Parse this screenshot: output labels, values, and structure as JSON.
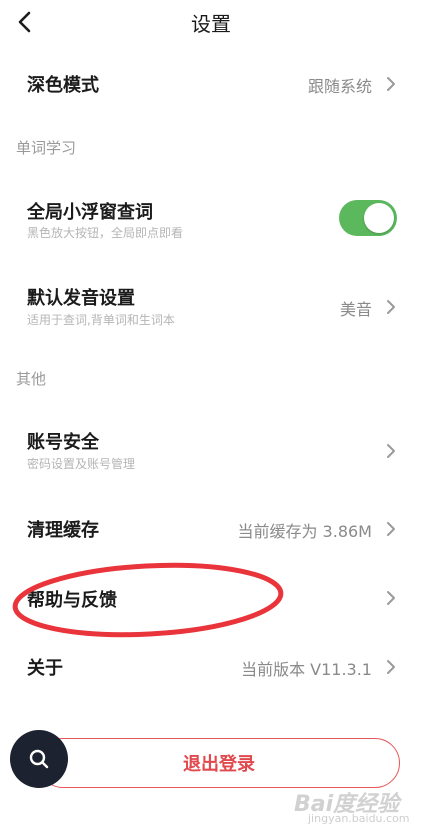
{
  "header": {
    "title": "设置"
  },
  "rows": {
    "dark_mode": {
      "title": "深色模式",
      "value": "跟随系统"
    },
    "float_lookup": {
      "title": "全局小浮窗查词",
      "subtitle": "黑色放大按钮，全局即点即看",
      "enabled": true
    },
    "pronunciation": {
      "title": "默认发音设置",
      "subtitle": "适用于查词,背单词和生词本",
      "value": "美音"
    },
    "account_security": {
      "title": "账号安全",
      "subtitle": "密码设置及账号管理"
    },
    "clear_cache": {
      "title": "清理缓存",
      "value": "当前缓存为 3.86M"
    },
    "help_feedback": {
      "title": "帮助与反馈"
    },
    "about": {
      "title": "关于",
      "value": "当前版本 V11.3.1"
    }
  },
  "sections": {
    "word_learning": "单词学习",
    "other": "其他"
  },
  "logout": {
    "label": "退出登录"
  },
  "colors": {
    "accent_red": "#e0494d",
    "toggle_green": "#5bb85c",
    "fab_dark": "#1c2230"
  },
  "icons": {
    "back": "chevron-left-icon",
    "search": "search-icon",
    "chevron": "chevron-right-icon"
  },
  "watermark": {
    "main": "Bai度经验",
    "sub": "jingyan.baidu.com"
  }
}
